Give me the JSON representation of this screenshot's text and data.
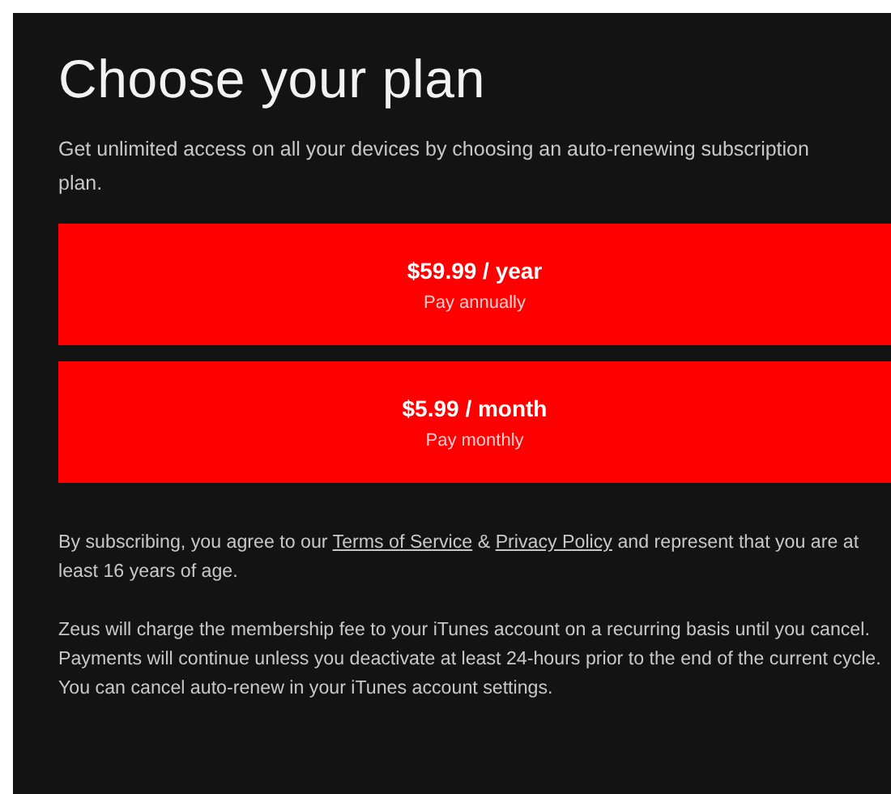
{
  "title": "Choose your plan",
  "subtitle": "Get unlimited access on all your devices by choosing an auto-renewing subscription plan.",
  "plans": [
    {
      "price": "$59.99 / year",
      "note": "Pay annually"
    },
    {
      "price": "$5.99 / month",
      "note": "Pay monthly"
    }
  ],
  "consent": [
    {
      "kind": "text",
      "text": "By subscribing, you agree to our "
    },
    {
      "kind": "link",
      "text": "Terms of Service"
    },
    {
      "kind": "text",
      "text": " & "
    },
    {
      "kind": "link",
      "text": "Privacy Policy"
    },
    {
      "kind": "text",
      "text": " and represent that you are at least 16 years of age."
    }
  ],
  "billing_note": "Zeus will charge the membership fee to your iTunes account on a recurring basis until you cancel. Payments will continue unless you deactivate at least 24-hours prior to the end of the current cycle. You can cancel auto-renew in your iTunes account settings."
}
